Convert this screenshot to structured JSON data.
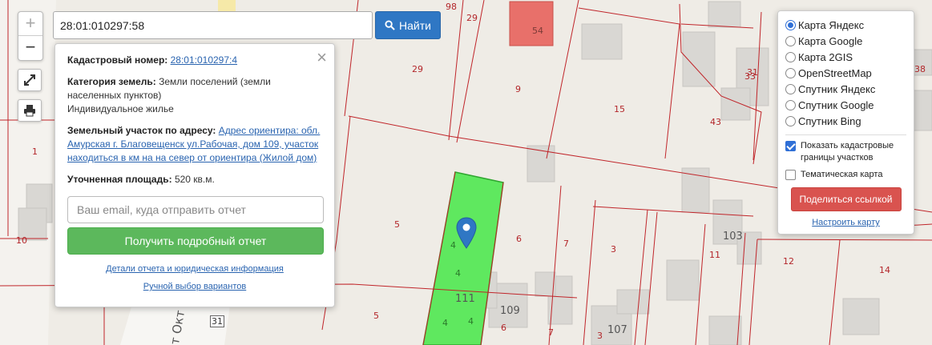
{
  "map": {
    "parcel_labels": [
      "98",
      "29",
      "54",
      "29",
      "9",
      "15",
      "31",
      "33",
      "38",
      "43",
      "1",
      "10",
      "5",
      "6",
      "7",
      "3",
      "11",
      "12",
      "14",
      "5",
      "6",
      "7",
      "3",
      "31"
    ],
    "house_labels": [
      "111",
      "109",
      "107",
      "103"
    ],
    "street_label": "т Окт",
    "small_labels": [
      "4",
      "4",
      "4",
      "4"
    ],
    "selected_parcel_color": "#5fe85f",
    "highlight_building_color": "#e8706a"
  },
  "zoom": {
    "in_label": "+",
    "out_label": "−"
  },
  "tools": {
    "fullscreen_icon": "expand-icon",
    "print_icon": "print-icon"
  },
  "search": {
    "value": "28:01:010297:58",
    "button_label": "Найти",
    "button_icon": "search-icon"
  },
  "info": {
    "cadastral_label": "Кадастровый номер:",
    "cadastral_value": "28:01:010297:4",
    "category_label": "Категория земель:",
    "category_value": "Земли поселений (земли населенных пунктов)",
    "usage_value": "Индивидуальное жилье",
    "address_label": "Земельный участок по адресу:",
    "address_value": "Адрес ориентира: обл. Амурская г. Благовещенск ул.Рабочая, дом 109, участок находиться в км на на север от ориентира (Жилой дом)",
    "area_label": "Уточненная площадь:",
    "area_value": "520 кв.м.",
    "email_placeholder": "Ваш email, куда отправить отчет",
    "report_button": "Получить подробный отчет",
    "details_link": "Детали отчета и юридическая информация",
    "manual_link": "Ручной выбор вариантов",
    "close_label": "×"
  },
  "layers": {
    "options": [
      {
        "label": "Карта Яндекс",
        "selected": true
      },
      {
        "label": "Карта Google",
        "selected": false
      },
      {
        "label": "Карта 2GIS",
        "selected": false
      },
      {
        "label": "OpenStreetMap",
        "selected": false
      },
      {
        "label": "Спутник Яндекс",
        "selected": false
      },
      {
        "label": "Спутник Google",
        "selected": false
      },
      {
        "label": "Спутник Bing",
        "selected": false
      }
    ],
    "show_borders_label": "Показать кадастровые границы участков",
    "show_borders_checked": true,
    "thematic_label": "Тематическая карта",
    "thematic_checked": false,
    "share_button": "Поделиться ссылкой",
    "configure_link": "Настроить карту"
  }
}
